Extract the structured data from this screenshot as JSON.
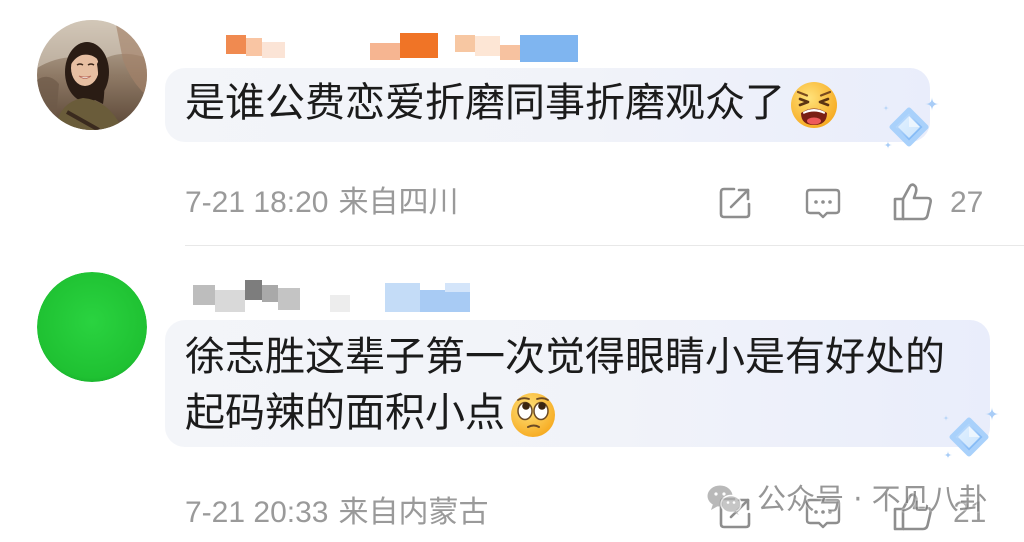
{
  "colors": {
    "text": "#1b1b1b",
    "meta": "#9a9a9a",
    "icon": "#8e8e8e",
    "divider": "#e8e8e8",
    "bubble_start": "#f3f5f9",
    "bubble_end": "#e9edfb",
    "avatar_green": "#1fc132",
    "watermark": "#7d7d7d"
  },
  "comments": [
    {
      "avatar": "user-photo-avatar",
      "text_lines": [
        "是谁公费恋爱折磨同事折磨观众了"
      ],
      "emoji": "tired-face",
      "badge": "diamond-badge",
      "time": "7-21 18:20",
      "location": "来自四川",
      "actions": {
        "share": "share-icon",
        "comment": "comment-icon",
        "like": "like-icon"
      },
      "like_count": "27"
    },
    {
      "avatar": "green-circle-avatar",
      "text_lines": [
        "徐志胜这辈子第一次觉得眼睛小是有好处的",
        "起码辣的面积小点"
      ],
      "emoji": "face-with-rolling-eyes",
      "badge": "diamond-badge",
      "time": "7-21 20:33",
      "location": "来自内蒙古",
      "actions": {
        "share": "share-icon",
        "comment": "comment-icon",
        "like": "like-icon"
      },
      "like_count": "21"
    }
  ],
  "watermark": {
    "icon": "wechat-icon",
    "text": "公众号 · 不见八卦"
  }
}
